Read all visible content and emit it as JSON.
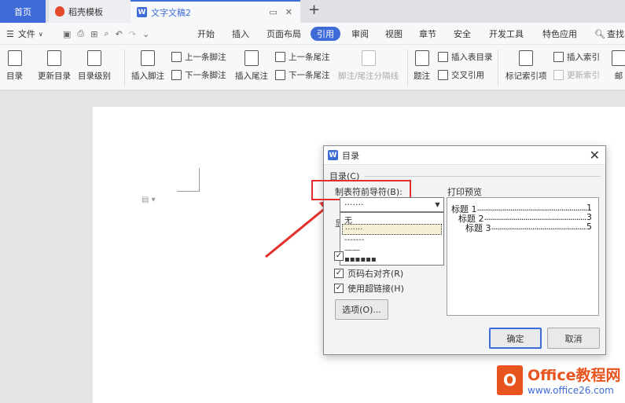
{
  "tabs": {
    "home": "首页",
    "daoke": "稻壳模板",
    "doc": "文字文稿2"
  },
  "menu": {
    "file": "文件",
    "items": [
      "开始",
      "插入",
      "页面布局",
      "引用",
      "审阅",
      "视图",
      "章节",
      "安全",
      "开发工具",
      "特色应用"
    ],
    "search": "查找"
  },
  "ribbon": {
    "toc": "目录",
    "update_toc": "更新目录",
    "toc_level": "目录级别",
    "insert_footnote": "插入脚注",
    "prev_footnote": "上一条脚注",
    "next_footnote": "下一条脚注",
    "insert_endnote": "插入尾注",
    "prev_endnote": "上一条尾注",
    "next_endnote": "下一条尾注",
    "separator": "脚注/尾注分隔线",
    "caption": "题注",
    "insert_table_of_figures": "插入表目录",
    "cross_ref": "交叉引用",
    "mark_index": "标记索引项",
    "insert_index": "插入索引",
    "update_index": "更新索引",
    "mail": "邮"
  },
  "dialog": {
    "title": "目录",
    "group": "目录(C)",
    "leader_label": "制表符前导符(B):",
    "leader_value": "·······",
    "options_items": [
      "无",
      "·······",
      "-------",
      "——",
      "▪▪▪▪▪▪"
    ],
    "partial_label": "显",
    "preview_label": "打印预览",
    "preview": [
      {
        "text": "标题 1",
        "page": "1"
      },
      {
        "text": "标题 2",
        "page": "3"
      },
      {
        "text": "标题 3",
        "page": "5"
      }
    ],
    "checks": [
      {
        "label": "",
        "checked": true
      },
      {
        "label": "页码右对齐(R)",
        "checked": true
      },
      {
        "label": "使用超链接(H)",
        "checked": true
      }
    ],
    "options_button": "选项(O)...",
    "ok": "确定",
    "cancel": "取消"
  },
  "watermark": {
    "line1": "Office教程网",
    "line2": "www.office26.com"
  },
  "colors": {
    "accent": "#3f6bd8",
    "highlight": "#e3302c",
    "brand": "#e8541e"
  }
}
